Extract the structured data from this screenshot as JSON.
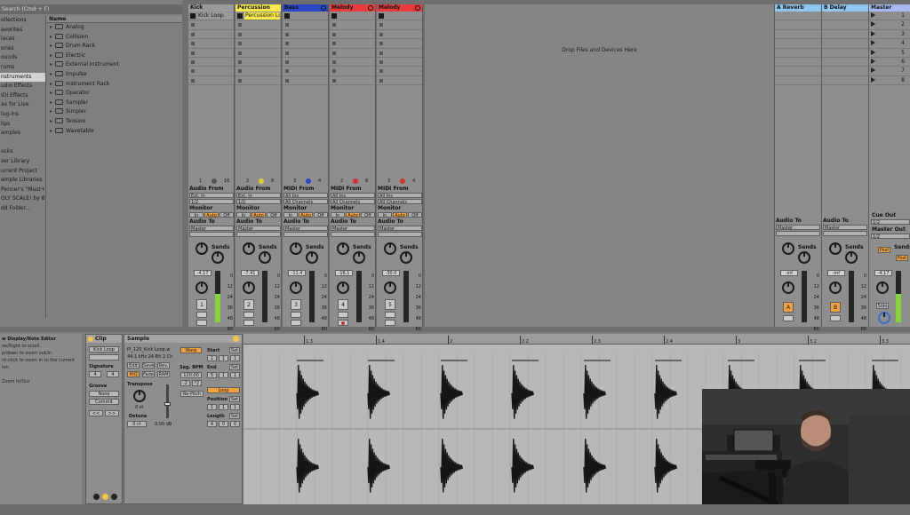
{
  "browser": {
    "search_placeholder": "Search (Cmd + F)",
    "categories": [
      "ollections",
      "avorites",
      "laces",
      "ories",
      "ounds",
      "rums",
      "nstruments",
      "udio Effects",
      "IDI Effects",
      "ax for Live",
      "lug-Ins",
      "lips",
      "amples",
      "",
      "ocks",
      "ser Library",
      "urrent Project",
      "ample Libraries",
      "Penner's \"Must+",
      "OLY SCALE! by 8 bit",
      "dd Folder..."
    ],
    "selected_category": 6,
    "name_header": "Name",
    "devices": [
      "Analog",
      "Collision",
      "Drum Rack",
      "Electric",
      "External Instrument",
      "Impulse",
      "Instrument Rack",
      "Operator",
      "Sampler",
      "Simpler",
      "Tension",
      "Wavetable"
    ]
  },
  "tracks": [
    {
      "name": "Kick",
      "color": "#9a9a9a",
      "clip": "Kick Loop",
      "clip_color": "#9a9a9a",
      "from_label": "Audio From",
      "from": "Ext. In",
      "channel": "1/2",
      "monitor": [
        "In",
        "Auto",
        "Off"
      ],
      "to": "Master",
      "vol": "-4.17",
      "num": "1",
      "meter": 0.55,
      "stat_left": "1",
      "stat_right": "16",
      "dot": "#555555"
    },
    {
      "name": "Percussion",
      "color": "#f7ea4a",
      "clip": "Percussion Loop",
      "clip_color": "#f7ea4a",
      "from_label": "Audio From",
      "from": "Ext. In",
      "channel": "1/2",
      "monitor": [
        "In",
        "Auto",
        "Off"
      ],
      "to": "Master",
      "vol": "-7.41",
      "num": "2",
      "meter": 0,
      "stat_left": "2",
      "stat_right": "8",
      "dot": "#e6c93a"
    },
    {
      "name": "Bass",
      "color": "#2c48c8",
      "clip": "",
      "clip_color": "",
      "from_label": "MIDI From",
      "from": "All Ins",
      "channel": "All Channels",
      "monitor": [
        "In",
        "Auto",
        "Off"
      ],
      "to": "Master",
      "vol": "-11.4",
      "num": "3",
      "meter": 0,
      "stat_left": "3",
      "stat_right": "4",
      "dot": "#2c48c8"
    },
    {
      "name": "Melody",
      "color": "#e83b3b",
      "clip": "",
      "clip_color": "",
      "from_label": "MIDI From",
      "from": "All Ins",
      "channel": "All Channels",
      "monitor": [
        "In",
        "Auto",
        "Off"
      ],
      "to": "Master",
      "vol": "-16.1",
      "num": "4",
      "meter": 0,
      "stat_left": "2",
      "stat_right": "8",
      "dot": "#d23232"
    },
    {
      "name": "Melody",
      "color": "#e83b3b",
      "clip": "",
      "clip_color": "",
      "from_label": "MIDI From",
      "from": "All Ins",
      "channel": "All Channels",
      "monitor": [
        "In",
        "Auto",
        "Off"
      ],
      "to": "Master",
      "vol": "-30.0",
      "num": "5",
      "meter": 0,
      "stat_left": "3",
      "stat_right": "4",
      "dot": "#d23232"
    }
  ],
  "drop_text": "Drop Files and Devices Here",
  "returns": [
    {
      "name": "A Reverb",
      "color": "#8fc6f0",
      "to": "Master",
      "vol": "-inf",
      "letter": "A"
    },
    {
      "name": "B Delay",
      "color": "#8fc6f0",
      "to": "Master",
      "vol": "-inf",
      "letter": "B"
    }
  ],
  "master": {
    "name": "Master",
    "color": "#a9b8f0",
    "scenes": [
      "1",
      "2",
      "3",
      "4",
      "5",
      "6",
      "7",
      "8"
    ],
    "cue_out_label": "Cue Out",
    "cue_out": "1/2",
    "master_out_label": "Master Out",
    "master_out": "1/2",
    "vol": "-4.17",
    "post": "Post",
    "solo": "Solo"
  },
  "common": {
    "audio_to": "Audio To",
    "monitor": "Monitor",
    "sends": "Sends",
    "scale": [
      "0",
      "12",
      "24",
      "36",
      "48",
      "60"
    ]
  },
  "help": {
    "title": "w Display/Note Editor",
    "lines": [
      "oe/Right to scroll.",
      "p/down to zoom out/in.",
      "nt-click to zoom in to the current",
      "ion.",
      "",
      "Zoom In/Out"
    ]
  },
  "clip_panel": {
    "title": "Clip",
    "name": "Kick Loop",
    "signature_label": "Signature",
    "sig_num": "4",
    "sig_den": "4",
    "groove_label": "Groove",
    "groove": "None",
    "commit": "Commit",
    "nudge_l": "<<",
    "nudge_r": ">>"
  },
  "sample_panel": {
    "title": "Sample",
    "file": "Pl_120_Kick Loop.w",
    "info": "44.1 kHz 24 Bit 2 Ch",
    "warp": "Warp",
    "edit": "Edit",
    "save": "Save",
    "rev": "Rev.",
    "hiq": "HiQ",
    "fade": "Fade",
    "ram": "RAM",
    "seg_bpm_label": "Seg. BPM",
    "bpm": "120.00",
    "halve": ":2",
    "double": "*2",
    "repitch": "Re-Pitch",
    "transpose_label": "Transpose",
    "transpose": "0 st",
    "detune_label": "Detune",
    "detune": "0 ct",
    "gain": "0.00 dB",
    "start_label": "Start",
    "end_label": "End",
    "set": "Set",
    "loop": "Loop",
    "position_label": "Position",
    "length_label": "Length",
    "start": [
      "1",
      "1",
      "1"
    ],
    "end": [
      "5",
      "1",
      "1"
    ],
    "position": [
      "1",
      "1",
      "1"
    ],
    "length": [
      "4",
      "0",
      "0"
    ]
  },
  "ruler": [
    "1.3",
    "1.4",
    "2",
    "2.2",
    "2.3",
    "2.4",
    "3",
    "3.2",
    "3.3"
  ]
}
